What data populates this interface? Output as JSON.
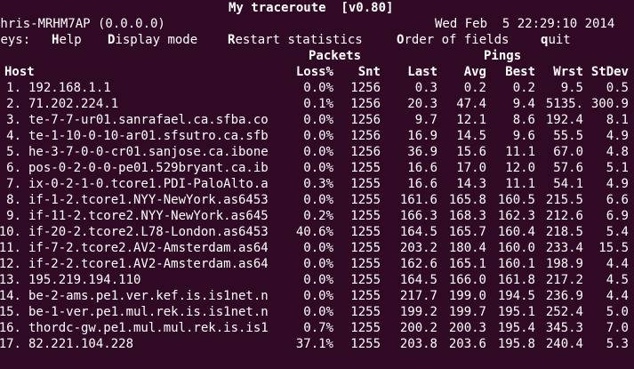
{
  "title": "My traceroute  [v0.80]",
  "host_info": "chris-MRHM7AP (0.0.0.0)",
  "datetime": "Wed Feb  5 22:29:10 2014",
  "keys_label": "Keys:",
  "keys": [
    {
      "hotkey": "H",
      "rest": "elp"
    },
    {
      "hotkey": "D",
      "rest": "isplay mode"
    },
    {
      "hotkey": "R",
      "rest": "estart statistics"
    },
    {
      "hotkey": "O",
      "rest": "rder of fields"
    },
    {
      "hotkey": "q",
      "rest": "uit"
    }
  ],
  "group_headers": {
    "packets": "Packets",
    "pings": "Pings"
  },
  "columns": {
    "host": "Host",
    "loss": "Loss%",
    "snt": "Snt",
    "last": "Last",
    "avg": "Avg",
    "best": "Best",
    "wrst": "Wrst",
    "stdev": "StDev"
  },
  "hops": [
    {
      "num": "1.",
      "host": "192.168.1.1",
      "loss": "0.0%",
      "snt": "1256",
      "last": "0.3",
      "avg": "0.2",
      "best": "0.2",
      "wrst": "9.5",
      "stdev": "0.5"
    },
    {
      "num": "2.",
      "host": "71.202.224.1",
      "loss": "0.1%",
      "snt": "1256",
      "last": "20.3",
      "avg": "47.4",
      "best": "9.4",
      "wrst": "5135.",
      "stdev": "300.9"
    },
    {
      "num": "3.",
      "host": "te-7-7-ur01.sanrafael.ca.sfba.co",
      "loss": "0.0%",
      "snt": "1256",
      "last": "9.7",
      "avg": "12.1",
      "best": "8.6",
      "wrst": "192.4",
      "stdev": "8.1"
    },
    {
      "num": "4.",
      "host": "te-1-10-0-10-ar01.sfsutro.ca.sfb",
      "loss": "0.0%",
      "snt": "1256",
      "last": "16.9",
      "avg": "14.5",
      "best": "9.6",
      "wrst": "55.5",
      "stdev": "4.9"
    },
    {
      "num": "5.",
      "host": "he-3-7-0-0-cr01.sanjose.ca.ibone",
      "loss": "0.0%",
      "snt": "1256",
      "last": "36.9",
      "avg": "15.6",
      "best": "11.1",
      "wrst": "67.0",
      "stdev": "4.8"
    },
    {
      "num": "6.",
      "host": "pos-0-2-0-0-pe01.529bryant.ca.ib",
      "loss": "0.0%",
      "snt": "1255",
      "last": "16.6",
      "avg": "17.0",
      "best": "12.0",
      "wrst": "57.6",
      "stdev": "5.1"
    },
    {
      "num": "7.",
      "host": "ix-0-2-1-0.tcore1.PDI-PaloAlto.a",
      "loss": "0.3%",
      "snt": "1255",
      "last": "16.6",
      "avg": "14.3",
      "best": "11.1",
      "wrst": "54.1",
      "stdev": "4.9"
    },
    {
      "num": "8.",
      "host": "if-1-2.tcore1.NYY-NewYork.as6453",
      "loss": "0.0%",
      "snt": "1255",
      "last": "161.6",
      "avg": "165.8",
      "best": "160.5",
      "wrst": "215.5",
      "stdev": "6.6"
    },
    {
      "num": "9.",
      "host": "if-11-2.tcore2.NYY-NewYork.as645",
      "loss": "0.2%",
      "snt": "1255",
      "last": "166.3",
      "avg": "168.3",
      "best": "162.3",
      "wrst": "212.6",
      "stdev": "6.9"
    },
    {
      "num": "10.",
      "host": "if-20-2.tcore2.L78-London.as6453",
      "loss": "40.6%",
      "snt": "1255",
      "last": "164.5",
      "avg": "165.7",
      "best": "160.4",
      "wrst": "218.5",
      "stdev": "5.4"
    },
    {
      "num": "11.",
      "host": "if-7-2.tcore2.AV2-Amsterdam.as64",
      "loss": "0.0%",
      "snt": "1255",
      "last": "203.2",
      "avg": "180.4",
      "best": "160.0",
      "wrst": "233.4",
      "stdev": "15.5"
    },
    {
      "num": "12.",
      "host": "if-2-2.tcore1.AV2-Amsterdam.as64",
      "loss": "0.0%",
      "snt": "1255",
      "last": "162.6",
      "avg": "165.1",
      "best": "160.1",
      "wrst": "198.9",
      "stdev": "4.4"
    },
    {
      "num": "13.",
      "host": "195.219.194.110",
      "loss": "0.0%",
      "snt": "1255",
      "last": "164.5",
      "avg": "166.0",
      "best": "161.8",
      "wrst": "217.2",
      "stdev": "4.5"
    },
    {
      "num": "14.",
      "host": "be-2-ams.pe1.ver.kef.is.is1net.n",
      "loss": "0.0%",
      "snt": "1255",
      "last": "217.7",
      "avg": "199.0",
      "best": "194.5",
      "wrst": "236.9",
      "stdev": "4.4"
    },
    {
      "num": "15.",
      "host": "be-1-ver.pe1.mul.rek.is.is1net.n",
      "loss": "0.0%",
      "snt": "1255",
      "last": "199.2",
      "avg": "199.7",
      "best": "195.1",
      "wrst": "252.4",
      "stdev": "5.0"
    },
    {
      "num": "16.",
      "host": "thordc-gw.pe1.mul.mul.rek.is.is1",
      "loss": "0.7%",
      "snt": "1255",
      "last": "200.2",
      "avg": "200.3",
      "best": "195.4",
      "wrst": "345.3",
      "stdev": "7.0"
    },
    {
      "num": "17.",
      "host": "82.221.104.228",
      "loss": "37.1%",
      "snt": "1255",
      "last": "203.8",
      "avg": "203.6",
      "best": "195.8",
      "wrst": "240.4",
      "stdev": "5.3"
    }
  ]
}
